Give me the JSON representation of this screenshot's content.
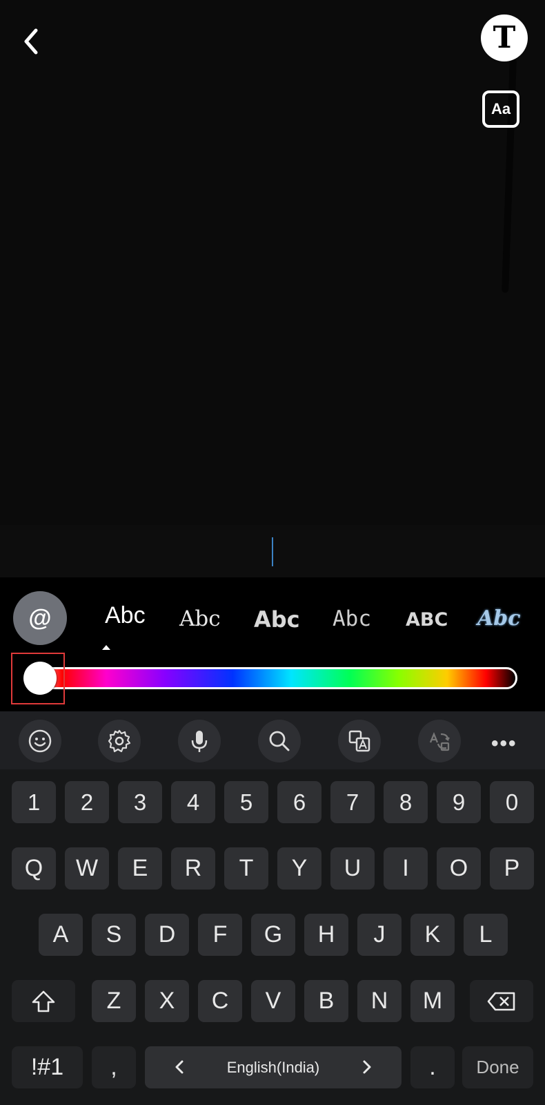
{
  "top": {
    "back_icon": "chevron-left-icon",
    "text_tool_label": "T",
    "font_style_label": "Aa"
  },
  "styles": {
    "mention_label": "@",
    "fonts": [
      "Abc",
      "Abc",
      "Abc",
      "Abc",
      "ABC",
      "Abc"
    ],
    "selected_font_index": 0
  },
  "color_slider": {
    "value": 0,
    "selected_color": "#ffffff"
  },
  "toolbar": {
    "icons": [
      "emoji-icon",
      "settings-icon",
      "microphone-icon",
      "search-icon",
      "translate-icon",
      "convert-icon"
    ],
    "more_label": "•••"
  },
  "keyboard": {
    "row_numbers": [
      "1",
      "2",
      "3",
      "4",
      "5",
      "6",
      "7",
      "8",
      "9",
      "0"
    ],
    "row_top": [
      "Q",
      "W",
      "E",
      "R",
      "T",
      "Y",
      "U",
      "I",
      "O",
      "P"
    ],
    "row_middle": [
      "A",
      "S",
      "D",
      "F",
      "G",
      "H",
      "J",
      "K",
      "L"
    ],
    "row_bottom": [
      "Z",
      "X",
      "C",
      "V",
      "B",
      "N",
      "M"
    ],
    "symbols_label": "!#1",
    "comma_label": ",",
    "space_label": "English(India)",
    "period_label": ".",
    "done_label": "Done"
  }
}
